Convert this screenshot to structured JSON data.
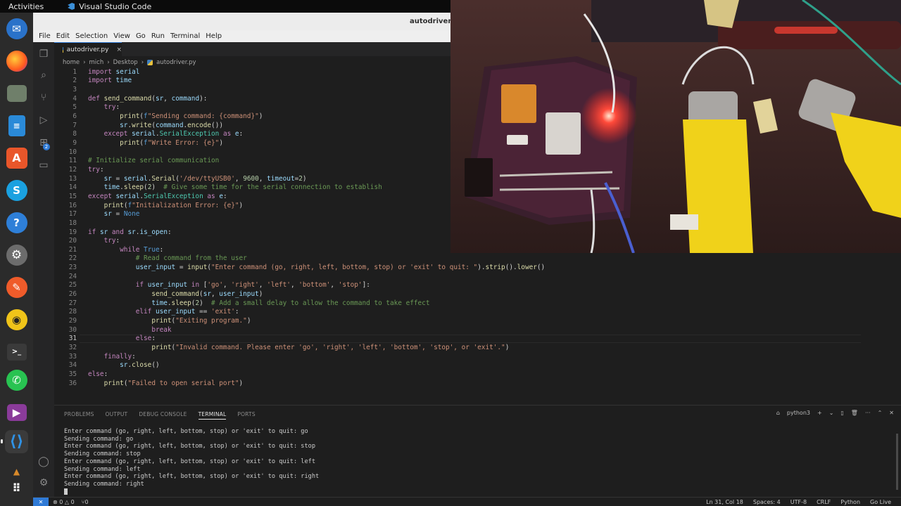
{
  "topbar": {
    "activities": "Activities",
    "app_name": "Visual Studio Code"
  },
  "window": {
    "title": "autodriver.py"
  },
  "menu": [
    "File",
    "Edit",
    "Selection",
    "View",
    "Go",
    "Run",
    "Terminal",
    "Help"
  ],
  "tab": {
    "label": "autodriver.py",
    "close": "×"
  },
  "breadcrumb": {
    "parts": [
      "home",
      "mich",
      "Desktop"
    ],
    "sep": "›",
    "file": "autodriver.py"
  },
  "activity": {
    "badge": "2"
  },
  "editor": {
    "current_line": 31,
    "lines": [
      {
        "n": "1",
        "t": "import serial"
      },
      {
        "n": "2",
        "t": "import time"
      },
      {
        "n": "3",
        "t": ""
      },
      {
        "n": "4",
        "t": "def send_command(sr, command):"
      },
      {
        "n": "5",
        "t": "    try:"
      },
      {
        "n": "6",
        "t": "        print(f\"Sending command: {command}\")"
      },
      {
        "n": "7",
        "t": "        sr.write(command.encode())"
      },
      {
        "n": "8",
        "t": "    except serial.SerialException as e:"
      },
      {
        "n": "9",
        "t": "        print(f\"Write Error: {e}\")"
      },
      {
        "n": "10",
        "t": ""
      },
      {
        "n": "11",
        "t": "# Initialize serial communication"
      },
      {
        "n": "12",
        "t": "try:"
      },
      {
        "n": "13",
        "t": "    sr = serial.Serial('/dev/ttyUSB0', 9600, timeout=2)"
      },
      {
        "n": "14",
        "t": "    time.sleep(2)  # Give some time for the serial connection to establish"
      },
      {
        "n": "15",
        "t": "except serial.SerialException as e:"
      },
      {
        "n": "16",
        "t": "    print(f\"Initialization Error: {e}\")"
      },
      {
        "n": "17",
        "t": "    sr = None"
      },
      {
        "n": "18",
        "t": ""
      },
      {
        "n": "19",
        "t": "if sr and sr.is_open:"
      },
      {
        "n": "20",
        "t": "    try:"
      },
      {
        "n": "21",
        "t": "        while True:"
      },
      {
        "n": "22",
        "t": "            # Read command from the user"
      },
      {
        "n": "23",
        "t": "            user_input = input(\"Enter command (go, right, left, bottom, stop) or 'exit' to quit: \").strip().lower()"
      },
      {
        "n": "24",
        "t": ""
      },
      {
        "n": "25",
        "t": "            if user_input in ['go', 'right', 'left', 'bottom', 'stop']:"
      },
      {
        "n": "26",
        "t": "                send_command(sr, user_input)"
      },
      {
        "n": "27",
        "t": "                time.sleep(2)  # Add a small delay to allow the command to take effect"
      },
      {
        "n": "28",
        "t": "            elif user_input == 'exit':"
      },
      {
        "n": "29",
        "t": "                print(\"Exiting program.\")"
      },
      {
        "n": "30",
        "t": "                break"
      },
      {
        "n": "31",
        "t": "            else:"
      },
      {
        "n": "32",
        "t": "                print(\"Invalid command. Please enter 'go', 'right', 'left', 'bottom', 'stop', or 'exit'.\")"
      },
      {
        "n": "33",
        "t": "    finally:"
      },
      {
        "n": "34",
        "t": "        sr.close()"
      },
      {
        "n": "35",
        "t": "else:"
      },
      {
        "n": "36",
        "t": "    print(\"Failed to open serial port\")"
      }
    ]
  },
  "panel": {
    "tabs": [
      "PROBLEMS",
      "OUTPUT",
      "DEBUG CONSOLE",
      "TERMINAL",
      "PORTS"
    ],
    "active_tab": "TERMINAL",
    "shell": "python3",
    "actions": [
      "+",
      "⌄",
      "▯",
      "🗑",
      "···",
      "⌃",
      "✕"
    ],
    "terminal_lines": [
      "Enter command (go, right, left, bottom, stop) or 'exit' to quit: go",
      "Sending command: go",
      "Enter command (go, right, left, bottom, stop) or 'exit' to quit: stop",
      "Sending command: stop",
      "Enter command (go, right, left, bottom, stop) or 'exit' to quit: left",
      "Sending command: left",
      "Enter command (go, right, left, bottom, stop) or 'exit' to quit: right",
      "Sending command: right"
    ]
  },
  "status": {
    "errors": "⊗ 0 △ 0",
    "ports": "⑂0",
    "position": "Ln 31, Col 18",
    "spaces": "Spaces: 4",
    "encoding": "UTF-8",
    "eol": "CRLF",
    "language": "Python",
    "golive": "Go Live"
  },
  "colors": {
    "accent": "#2f7ad6",
    "keyword": "#c586c0",
    "builtin_keyword": "#569cd6",
    "function": "#dcdcaa",
    "string": "#ce9178",
    "comment": "#6a9955"
  }
}
